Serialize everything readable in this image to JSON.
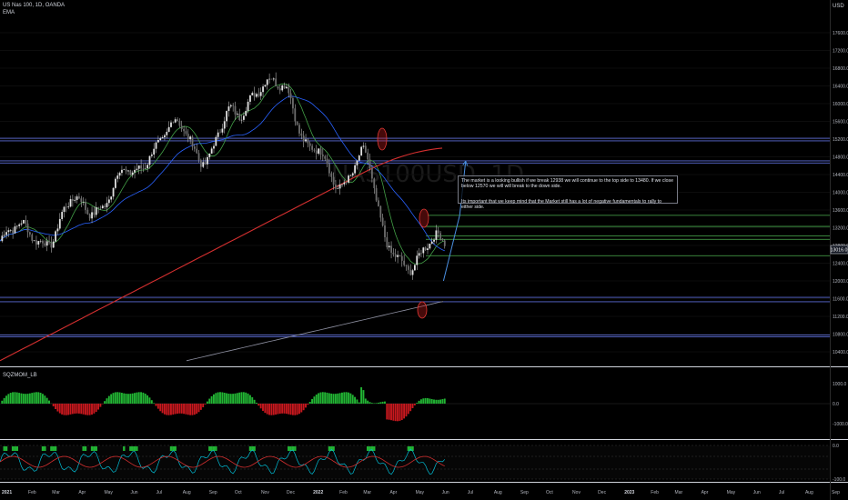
{
  "header": {
    "symbol_line": "US Nas 100, 1D, OANDA",
    "indicator_ema": "EMA",
    "currency": "USD"
  },
  "watermark": "NAS100USD, 1D",
  "annotation": {
    "line1": "The market is a looking bullish if we break 12938 we will continue to the top side to 13480. If we close below 12570 we will will break to the down side.",
    "line2": "Its important that we keep mind that the Market still has a lot of negative fundamentals to rally to either side."
  },
  "price_axis": {
    "labels": [
      "17600.0",
      "17200.0",
      "16800.0",
      "16400.0",
      "16000.0",
      "15600.0",
      "15200.0",
      "14800.0",
      "14400.0",
      "14000.0",
      "13600.0",
      "13200.0",
      "12800.0",
      "12400.0",
      "12000.0",
      "11600.0",
      "11200.0",
      "10800.0",
      "10400.0"
    ],
    "current_price": "13016.0"
  },
  "osc1": {
    "name": "SQZMOM_LB",
    "labels": [
      "1000.0",
      "0.0",
      "-1000.0"
    ]
  },
  "osc2": {
    "labels": [
      "0.0",
      "-100.0"
    ]
  },
  "time_axis": {
    "labels": [
      "2021",
      "Feb",
      "Mar",
      "Apr",
      "May",
      "Jun",
      "Jul",
      "Aug",
      "Sep",
      "Oct",
      "Nov",
      "Dec",
      "2022",
      "Feb",
      "Mar",
      "Apr",
      "May",
      "Jun",
      "Jul",
      "Aug",
      "Sep",
      "Oct",
      "Nov",
      "Dec",
      "2023",
      "Feb",
      "Mar",
      "Apr",
      "May",
      "Jun",
      "Jul",
      "Aug",
      "Sep"
    ]
  },
  "chart_data": {
    "type": "candlestick",
    "symbol": "US Nas 100",
    "timeframe": "1D",
    "y_range": [
      10200,
      17900
    ],
    "x_range": [
      "2021-01",
      "2023-09"
    ],
    "close_series_monthly": [
      {
        "x": "2021-01",
        "y": 12900
      },
      {
        "x": "2021-02",
        "y": 13200
      },
      {
        "x": "2021-03",
        "y": 12900
      },
      {
        "x": "2021-04",
        "y": 13850
      },
      {
        "x": "2021-05",
        "y": 13650
      },
      {
        "x": "2021-06",
        "y": 14500
      },
      {
        "x": "2021-07",
        "y": 14950
      },
      {
        "x": "2021-08",
        "y": 15550
      },
      {
        "x": "2021-09",
        "y": 14700
      },
      {
        "x": "2021-10",
        "y": 15850
      },
      {
        "x": "2021-11",
        "y": 16300
      },
      {
        "x": "2021-12",
        "y": 16400
      },
      {
        "x": "2022-01",
        "y": 14950
      },
      {
        "x": "2022-02",
        "y": 14200
      },
      {
        "x": "2022-03",
        "y": 14850
      },
      {
        "x": "2022-04",
        "y": 12850
      },
      {
        "x": "2022-05",
        "y": 12300
      },
      {
        "x": "2022-06",
        "y": 13016
      }
    ],
    "horizontal_levels": [
      15220,
      15160,
      14710,
      14660,
      13480,
      13230,
      13016,
      12938,
      12570,
      11630,
      11530,
      10780,
      10740
    ],
    "current_price": 13016,
    "projection": [
      {
        "x": "2022-06-05",
        "y": 12000
      },
      {
        "x": "2022-06-24",
        "y": 13480
      },
      {
        "x": "2022-07-01",
        "y": 14700
      }
    ]
  },
  "colors": {
    "bullish": "#26a69a",
    "bearish": "#ef5350",
    "ma_red": "#d32f2f",
    "ma_blue": "#2962ff",
    "ma_green": "#43a047",
    "level_blue": "#5b6cd6",
    "level_green": "#4caf50",
    "osc_green": "#22b534",
    "osc_red": "#c8181e",
    "rsi_cyan": "#00bcd4"
  }
}
